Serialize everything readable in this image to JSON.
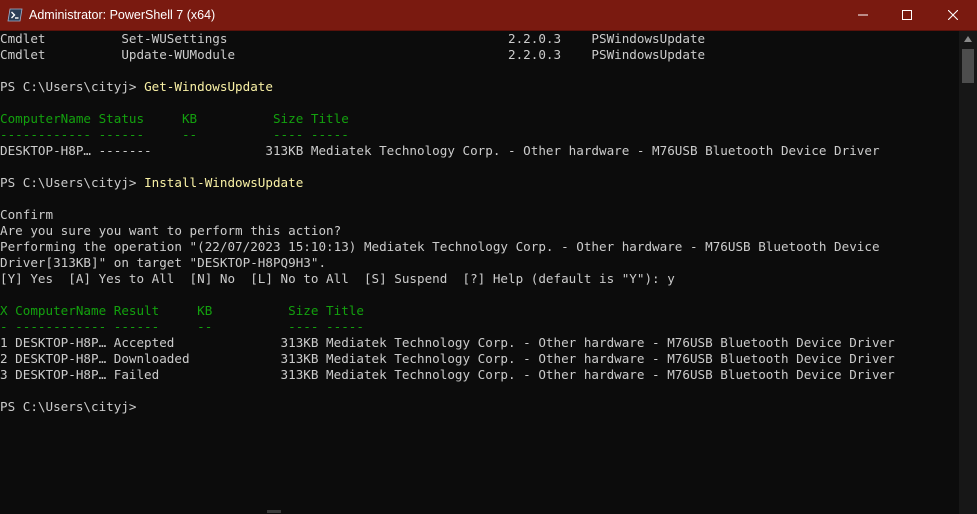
{
  "window": {
    "title": "Administrator: PowerShell 7 (x64)",
    "accent": "#7a1a10"
  },
  "icons": {
    "app": "powershell-icon",
    "minimize": "minimize-icon",
    "maximize": "maximize-icon",
    "close": "close-icon",
    "scroll_up": "chevron-up-icon"
  },
  "lines": [
    "Cmdlet          Set-WUSettings                                     2.2.0.3    PSWindowsUpdate",
    "Cmdlet          Update-WUModule                                    2.2.0.3    PSWindowsUpdate",
    "",
    "PS C:\\Users\\cityj> ",
    "",
    "ComputerName Status     KB          Size Title",
    "------------ ------     --          ---- -----",
    "DESKTOP-H8P… -------               313KB Mediatek Technology Corp. - Other hardware - M76USB Bluetooth Device Driver",
    "",
    "PS C:\\Users\\cityj> ",
    "",
    "Confirm",
    "Are you sure you want to perform this action?",
    "Performing the operation \"(22/07/2023 15:10:13) Mediatek Technology Corp. - Other hardware - M76USB Bluetooth Device",
    "Driver[313KB]\" on target \"DESKTOP-H8PQ9H3\".",
    "[Y] Yes  [A] Yes to All  [N] No  [L] No to All  [S] Suspend  [?] Help (default is \"Y\"): y",
    "",
    "X ComputerName Result     KB          Size Title",
    "- ------------ ------     --          ---- -----",
    "1 DESKTOP-H8P… Accepted              313KB Mediatek Technology Corp. - Other hardware - M76USB Bluetooth Device Driver",
    "2 DESKTOP-H8P… Downloaded            313KB Mediatek Technology Corp. - Other hardware - M76USB Bluetooth Device Driver",
    "3 DESKTOP-H8P… Failed                313KB Mediatek Technology Corp. - Other hardware - M76USB Bluetooth Device Driver",
    "",
    "PS C:\\Users\\cityj>"
  ],
  "commands": {
    "get_update": "Get-WindowsUpdate",
    "install_update": "Install-WindowsUpdate"
  },
  "colors": {
    "text": "#cccccc",
    "header": "#13a10e",
    "command": "#f9f1a5",
    "background": "#0c0c0c"
  }
}
